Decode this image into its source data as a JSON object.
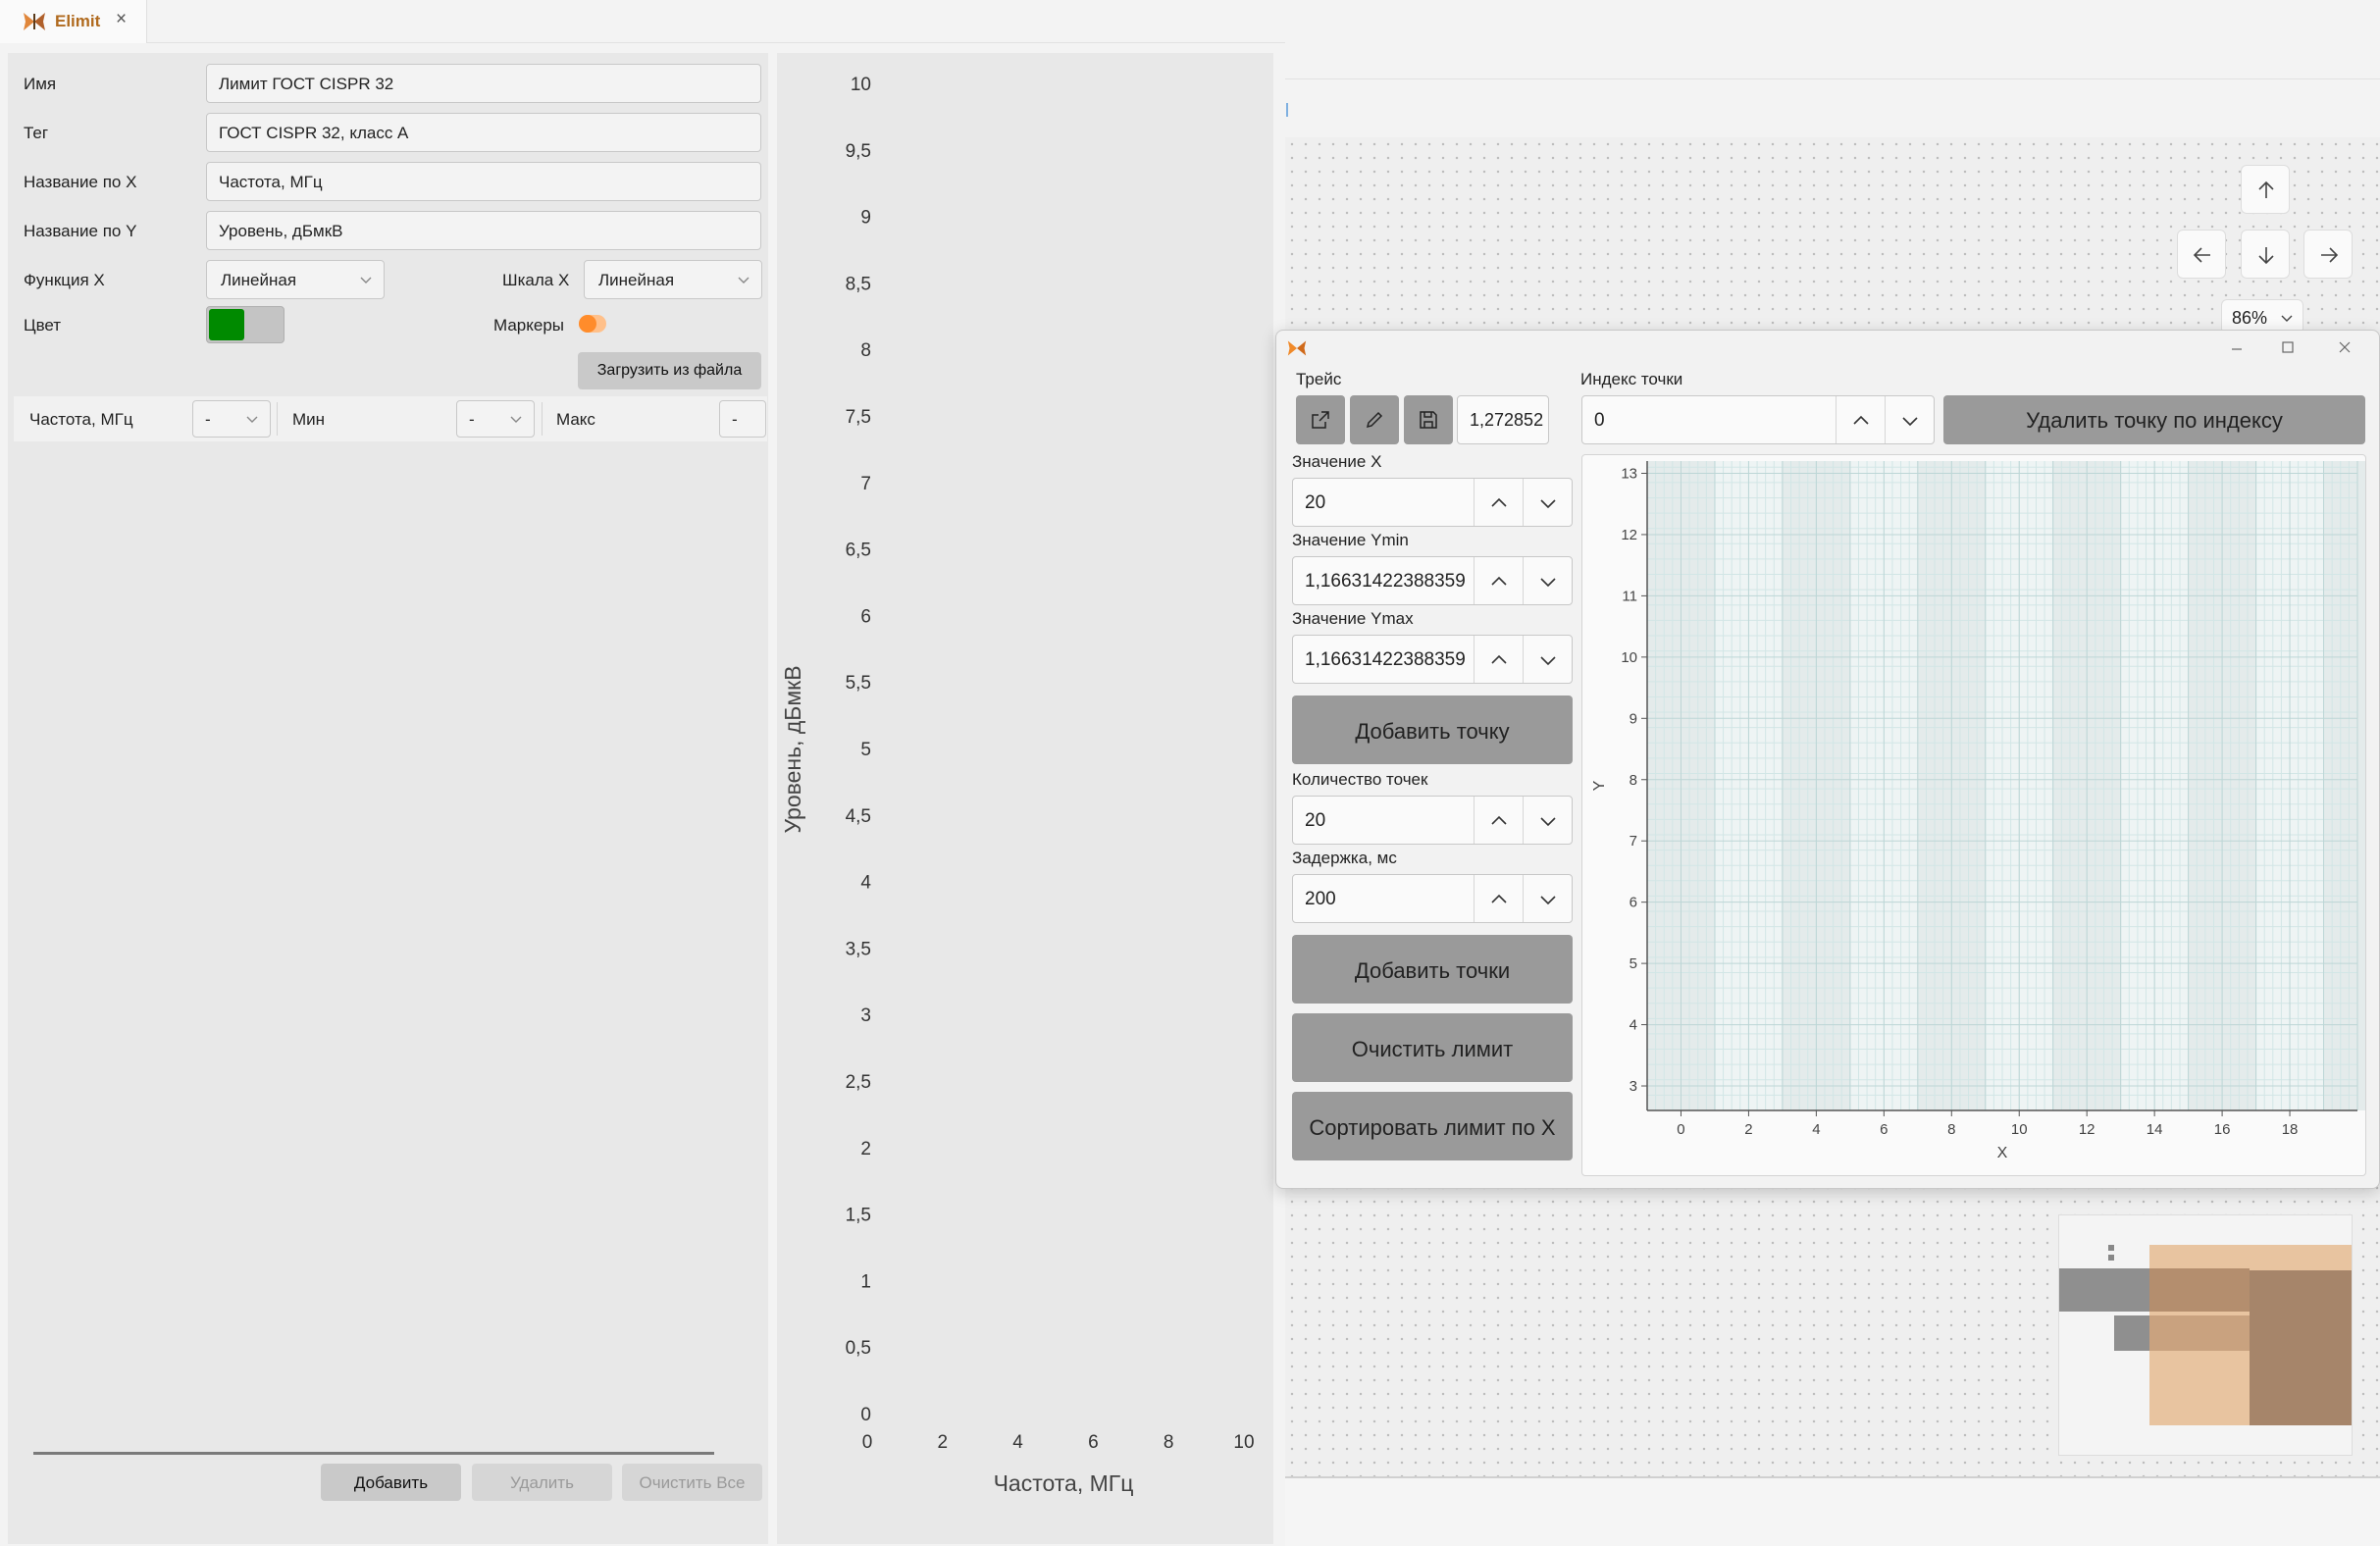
{
  "tab": {
    "title": "Elimit",
    "close": "×"
  },
  "form": {
    "name_label": "Имя",
    "name_value": "Лимит ГОСТ CISPR 32",
    "tag_label": "Тег",
    "tag_value": "ГОСТ CISPR 32, класс А",
    "xname_label": "Название по X",
    "xname_value": "Частота, МГц",
    "yname_label": "Название по Y",
    "yname_value": "Уровень, дБмкВ",
    "funcx_label": "Функция X",
    "funcx_value": "Линейная",
    "scalex_label": "Шкала X",
    "scalex_value": "Линейная",
    "color_label": "Цвет",
    "color_hex": "#008a00",
    "markers_label": "Маркеры",
    "markers_color": "#ff8c2b",
    "load_button": "Загрузить из файла"
  },
  "table": {
    "columns": [
      {
        "label": "Частота, МГц",
        "filter": "-"
      },
      {
        "label": "Мин",
        "filter": "-"
      },
      {
        "label": "Макс",
        "filter": "-"
      }
    ]
  },
  "table_buttons": {
    "add": "Добавить",
    "delete": "Удалить",
    "clear": "Очистить Все"
  },
  "chart_data": [
    {
      "type": "line",
      "xlabel": "Частота, МГц",
      "ylabel": "Уровень, дБмкВ",
      "xlim": [
        0,
        10
      ],
      "ylim": [
        0,
        10
      ],
      "x_ticks": [
        "0",
        "2",
        "4",
        "6",
        "8",
        "10"
      ],
      "y_ticks": [
        "0",
        "0,5",
        "1",
        "1,5",
        "2",
        "2,5",
        "3",
        "3,5",
        "4",
        "4,5",
        "5",
        "5,5",
        "6",
        "6,5",
        "7",
        "7,5",
        "8",
        "8,5",
        "9",
        "9,5",
        "10"
      ],
      "series": []
    },
    {
      "type": "scatter",
      "xlabel": "X",
      "ylabel": "Y",
      "xlim": [
        -1,
        20
      ],
      "ylim": [
        2.6,
        13.2
      ],
      "x_ticks": [
        "0",
        "2",
        "4",
        "6",
        "8",
        "10",
        "12",
        "14",
        "16",
        "18"
      ],
      "y_ticks": [
        "3",
        "4",
        "5",
        "6",
        "7",
        "8",
        "9",
        "10",
        "11",
        "12",
        "13"
      ],
      "grid": true,
      "series": []
    }
  ],
  "canvas": {
    "zoom": "86%"
  },
  "dialog": {
    "trace_label": "Трейс",
    "trace_value": "1,272852",
    "index_label": "Индекс точки",
    "index_value": "0",
    "delete_by_index": "Удалить точку по индексу",
    "x_label": "Значение X",
    "x_value": "20",
    "ymin_label": "Значение Ymin",
    "ymin_value": "1,16631422388359",
    "ymax_label": "Значение Ymax",
    "ymax_value": "1,16631422388359",
    "add_point": "Добавить точку",
    "count_label": "Количество точек",
    "count_value": "20",
    "delay_label": "Задержка, мс",
    "delay_value": "200",
    "add_points": "Добавить точки",
    "clear_limit": "Очистить лимит",
    "sort_limit": "Сортировать лимит по X"
  }
}
